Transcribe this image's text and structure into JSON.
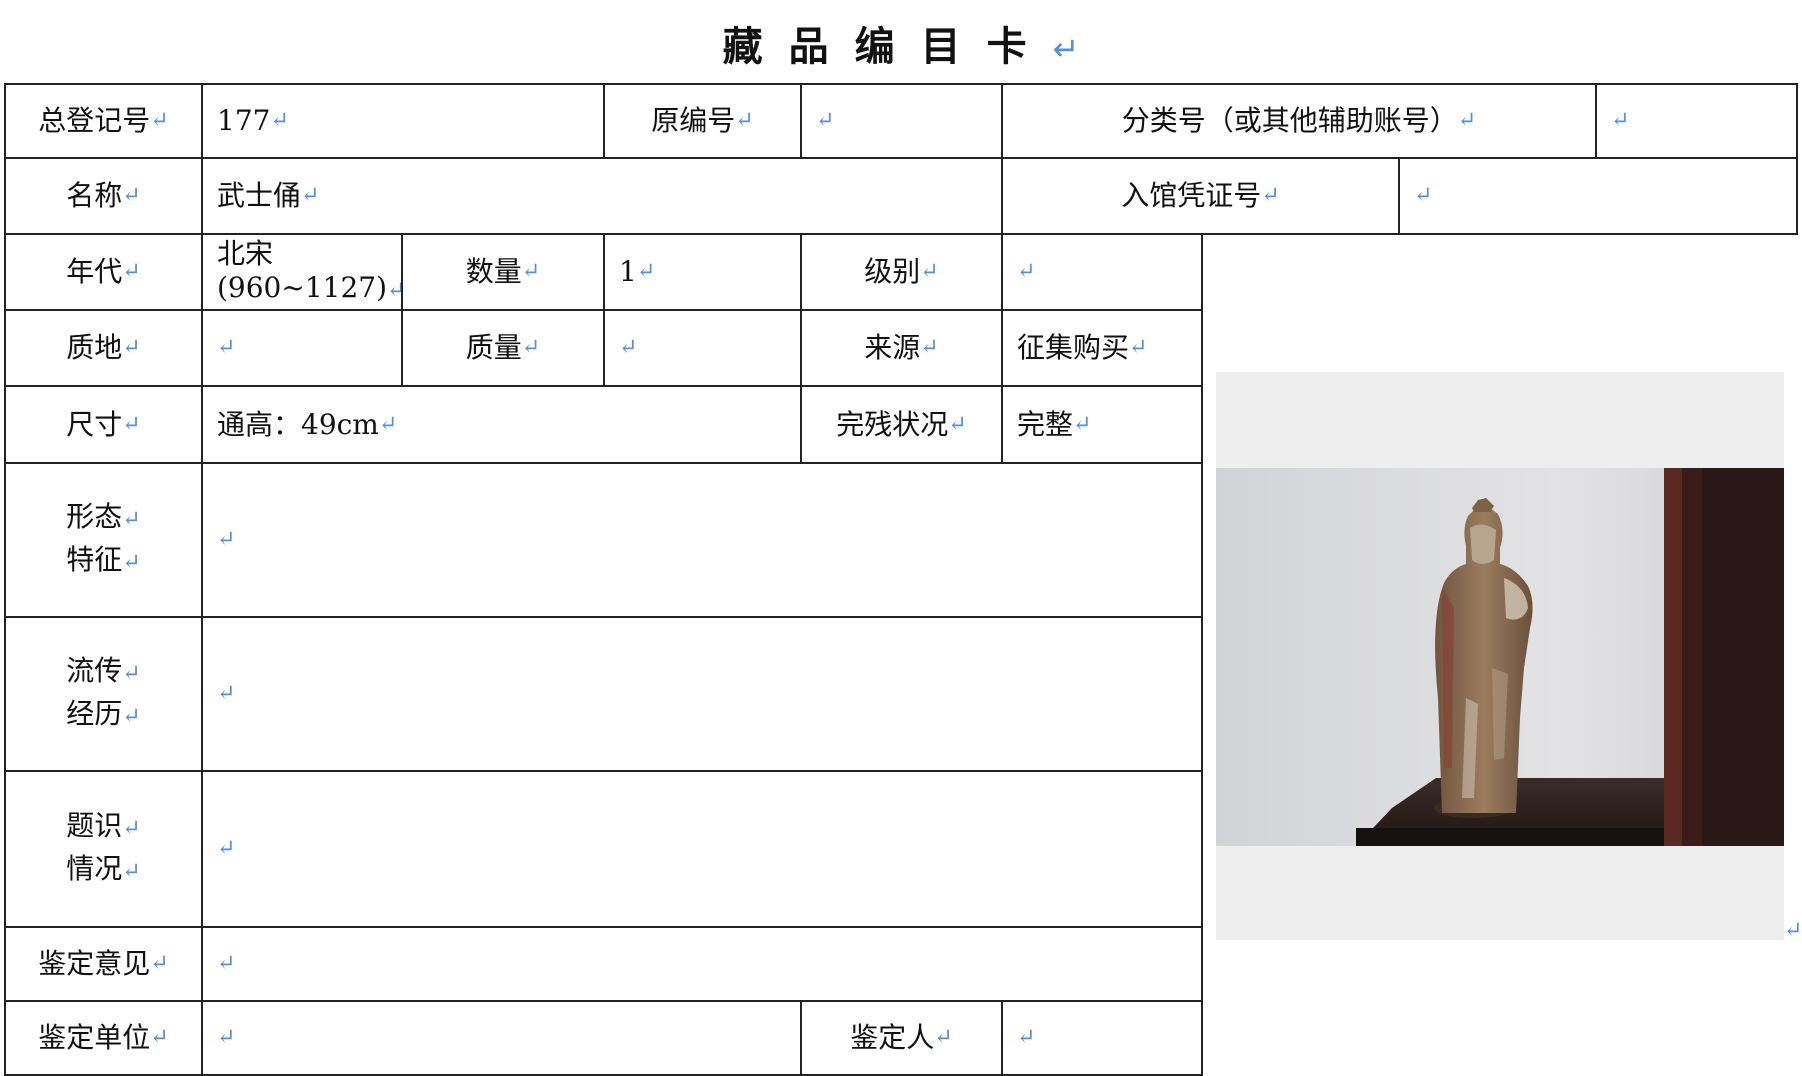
{
  "title": "藏品编目卡",
  "return_mark": "↵",
  "fields": {
    "register_no": {
      "label": "总登记号",
      "value": "177"
    },
    "original_no": {
      "label": "原编号",
      "value": ""
    },
    "class_no": {
      "label": "分类号（或其他辅助账号）",
      "value": ""
    },
    "name": {
      "label": "名称",
      "value": "武士俑"
    },
    "entry_voucher": {
      "label": "入馆凭证号",
      "value": ""
    },
    "era": {
      "label": "年代",
      "value_line1": "北宋",
      "value_line2": "(960~1127)"
    },
    "quantity": {
      "label": "数量",
      "value": "1"
    },
    "grade": {
      "label": "级别",
      "value": ""
    },
    "material": {
      "label": "质地",
      "value": ""
    },
    "weight": {
      "label": "质量",
      "value": ""
    },
    "source": {
      "label": "来源",
      "value": "征集购买"
    },
    "size": {
      "label": "尺寸",
      "value": "通高：49cm"
    },
    "condition": {
      "label": "完残状况",
      "value": "完整"
    },
    "shape": {
      "label_line1": "形态",
      "label_line2": "特征",
      "value": ""
    },
    "provenance": {
      "label_line1": "流传",
      "label_line2": "经历",
      "value": ""
    },
    "inscription": {
      "label_line1": "题识",
      "label_line2": "情况",
      "value": ""
    },
    "appraisal_opinion": {
      "label": "鉴定意见",
      "value": ""
    },
    "appraisal_unit": {
      "label": "鉴定单位",
      "value": ""
    },
    "appraiser": {
      "label": "鉴定人",
      "value": ""
    }
  },
  "photo": {
    "subject": "warrior figurine photograph",
    "wall_color": "#d9d9db",
    "table_color": "#2a1f1d",
    "figure_color": "#8a6a4c"
  }
}
